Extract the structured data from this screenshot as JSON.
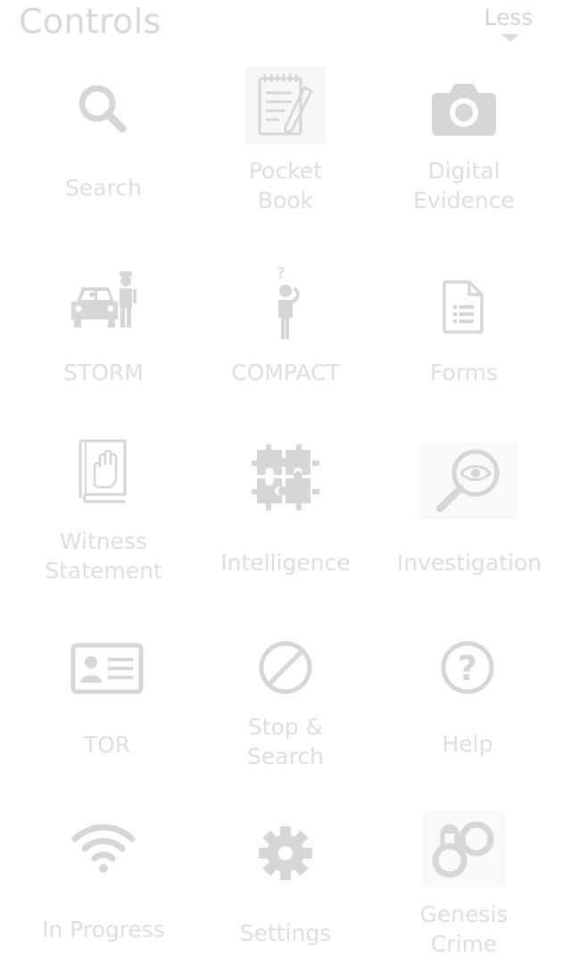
{
  "header": {
    "title": "Controls",
    "toggle_label": "Less"
  },
  "tiles": [
    {
      "id": "search",
      "label_lines": [
        "Search"
      ],
      "icon": "magnifier-icon"
    },
    {
      "id": "pocket-book",
      "label_lines": [
        "Pocket",
        "Book"
      ],
      "icon": "notepad-pencil-icon"
    },
    {
      "id": "digital-evidence",
      "label_lines": [
        "Digital",
        "Evidence"
      ],
      "icon": "camera-icon"
    },
    {
      "id": "storm",
      "label_lines": [
        "STORM"
      ],
      "icon": "car-officer-icon"
    },
    {
      "id": "compact",
      "label_lines": [
        "COMPACT"
      ],
      "icon": "person-question-icon"
    },
    {
      "id": "forms",
      "label_lines": [
        "Forms"
      ],
      "icon": "document-list-icon"
    },
    {
      "id": "witness-statement",
      "label_lines": [
        "Witness",
        "Statement"
      ],
      "icon": "book-hand-icon"
    },
    {
      "id": "intelligence",
      "label_lines": [
        "Intelligence"
      ],
      "icon": "puzzle-icon"
    },
    {
      "id": "investigation",
      "label_lines": [
        "Investigation"
      ],
      "icon": "magnifier-eye-icon"
    },
    {
      "id": "tor",
      "label_lines": [
        "TOR"
      ],
      "icon": "id-card-icon"
    },
    {
      "id": "stop-and-search",
      "label_lines": [
        "Stop &",
        "Search"
      ],
      "icon": "prohibited-icon"
    },
    {
      "id": "help",
      "label_lines": [
        "Help"
      ],
      "icon": "question-circle-icon"
    },
    {
      "id": "in-progress",
      "label_lines": [
        "In Progress"
      ],
      "icon": "wifi-icon"
    },
    {
      "id": "settings",
      "label_lines": [
        "Settings"
      ],
      "icon": "gear-icon"
    },
    {
      "id": "genesis-crime",
      "label_lines": [
        "Genesis",
        "Crime"
      ],
      "icon": "handcuffs-icon"
    }
  ],
  "colors": {
    "title": "#d8d8d8",
    "label": "#dedede",
    "icon": "#d6d6d6",
    "icon_background": "#f7f7f7"
  }
}
